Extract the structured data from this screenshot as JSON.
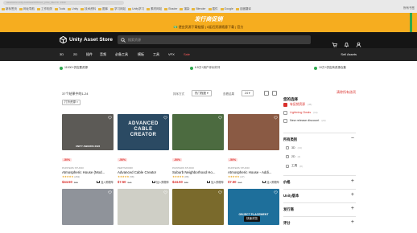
{
  "browser": {
    "url": "assetstore.unity.com/search#nf-ec_price_filter=0...1500",
    "bookmarks": [
      "新标签页",
      "网址导航",
      "工作相关",
      "Tools",
      "Unity",
      "技术资料",
      "图库",
      "学习网站",
      "Unity学习",
      "素材网站",
      "Shader",
      "渲染",
      "Blender",
      "插件",
      "Google",
      "百度翻译"
    ],
    "more_label": "所有书签"
  },
  "promo": {
    "title": "发行商促销",
    "subtitle": "💵 便宜资源下载链接 | 0延迟资源随意下载 | 官方"
  },
  "header": {
    "logo_text": "Unity Asset Store",
    "search_placeholder": "搜索资源"
  },
  "nav": {
    "categories": [
      "3D",
      "2D",
      "插件",
      "音频",
      "必备工具",
      "模板",
      "工具",
      "VFX",
      "Sale"
    ],
    "sell_label": "Sell Assets"
  },
  "info": {
    "left": "11000+供应要资源",
    "middle": "6.5万+用户评价好评",
    "right": "10万+供应商资源合集"
  },
  "results": {
    "count_text": "37个结果中的1-24",
    "active_filter": "打折资源 ×",
    "sort_label": "排序方式",
    "sort_value": "热门程度 ▾",
    "per_page_label": "查看结果",
    "per_page_value": "24 ▾"
  },
  "products": [
    {
      "thumb_text": "UNITY AWARDS 2023",
      "discount": "-50%",
      "publisher": "PAINTERS STUDIO",
      "title": "Atmospheric House (Mod...",
      "stars": "★★★★★",
      "rating_count": "(263)",
      "price": "$44.50",
      "old_price": "$89",
      "cart": "加入购物车",
      "color": "#5c5a56"
    },
    {
      "thumb_text": "ADVANCED CABLE CREATOR",
      "discount": "-50%",
      "publisher": "PERTSWORK",
      "title": "Advanced Cable Creator",
      "stars": "★★★★★",
      "rating_count": "(58)",
      "price": "$7.50",
      "old_price": "$15",
      "cart": "加入购物车",
      "color": "#2b4a63"
    },
    {
      "thumb_text": "",
      "discount": "-50%",
      "publisher": "PAINTERS STUDIO",
      "title": "Suburb Neighborhood Ho...",
      "stars": "★★★★★",
      "rating_count": "(88)",
      "price": "$44.50",
      "old_price": "$89",
      "cart": "加入购物车",
      "color": "#4c6b40"
    },
    {
      "thumb_text": "",
      "discount": "-50%",
      "publisher": "PAINTERS STUDIO",
      "title": "Atmospheric House - Addi...",
      "stars": "★★★★★",
      "rating_count": "(17)",
      "price": "$7.50",
      "old_price": "$15",
      "cart": "加入购物车",
      "color": "#8a5a44"
    },
    {
      "thumb_text": "",
      "color": "#8f939a"
    },
    {
      "thumb_text": "",
      "color": "#cfcfc6"
    },
    {
      "thumb_text": "",
      "color": "#7a6a2c"
    },
    {
      "thumb_text": "OBJECT PLACEMENT",
      "overlay": "快速浏览",
      "color": "#1e6f9b"
    }
  ],
  "filters": {
    "title": "您的选择",
    "clear_label": "清除所有选项",
    "options": [
      {
        "label": "有促销资源",
        "count": "(45)",
        "checked": true
      },
      {
        "label": "Lightning Deals",
        "count": "(14)",
        "checked": false
      },
      {
        "label": "New release discount",
        "count": "(20)",
        "checked": false
      }
    ],
    "categories_title": "所有类别",
    "category_items": [
      {
        "label": "3D",
        "count": "(13)"
      },
      {
        "label": "2D",
        "count": "(4)"
      },
      {
        "label": "工具",
        "count": "(8)"
      }
    ],
    "sections": [
      "价格",
      "Unity版本",
      "发行商",
      "评分"
    ]
  },
  "colors": {
    "accent": "#d9302c",
    "promo": "#f6ad1f",
    "header": "#151515"
  }
}
